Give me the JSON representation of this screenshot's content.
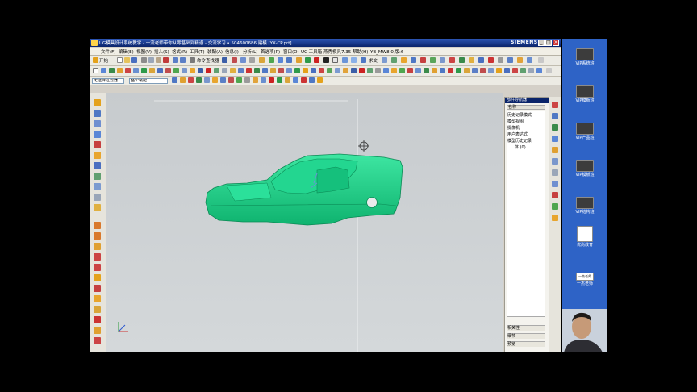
{
  "window": {
    "title": "UG模具设计系统教学 - 一流老师带你从零基础到精通 - 交流学习 • 504600686    建模    [YX-CP.prt]",
    "brand": "SIEMENS",
    "min_glyph": "_",
    "max_glyph": "□",
    "close_glyph": "×"
  },
  "menubar": {
    "items": [
      "文件(F)",
      "编辑(E)",
      "视图(V)",
      "插入(S)",
      "格式(R)",
      "工具(T)",
      "装配(A)",
      "信息(I)",
      "分析(L)",
      "首选项(P)",
      "窗口(O)",
      "UC 工具箱",
      "燕秀模具7.35",
      "帮助(H)",
      "YB_MW8.0 版:6"
    ]
  },
  "toolbar": {
    "start_label": "开始",
    "cmd_finder_label": "命令查找器",
    "bool_label": "求交",
    "filter_label": "整个装配",
    "selection_filter": "无选择过滤器"
  },
  "navigator": {
    "title": "部件导航器",
    "column_name": "名称",
    "items": [
      "历史记录模式",
      "模型视图",
      "摄像机",
      "用户表达式",
      "模型历史记录",
      "体 (0)"
    ],
    "sections": [
      "相关性",
      "细节",
      "预览"
    ]
  },
  "desktop": {
    "icons": [
      "VIP系统班",
      "VIP模板班",
      "VIP产品班",
      "VIP模板班",
      "VIP结构班",
      "优尚教育",
      "一杰老师"
    ],
    "highlight_label": "一杰老师"
  },
  "colors": {
    "model_green": "#1fd28a",
    "desktop_blue": "#2e63c6",
    "title_blue": "#0a246a"
  }
}
